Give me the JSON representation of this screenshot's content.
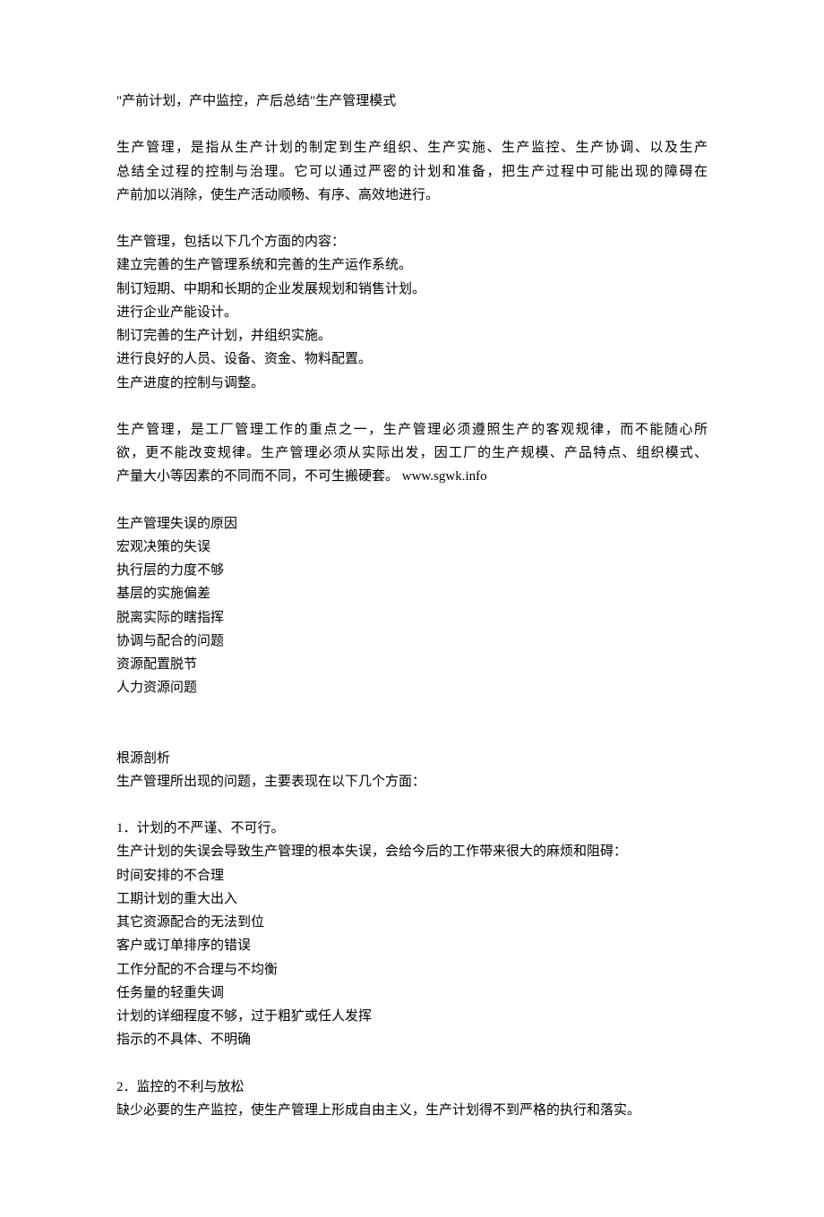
{
  "title": "\"产前计划，产中监控，产后总结\"生产管理模式",
  "intro_p1_l1": "生产管理，是指从生产计划的制定到生产组织、生产实施、生产监控、生产协调、以及生产",
  "intro_p1_l2": "总结全过程的控制与治理。它可以通过严密的计划和准备，把生产过程中可能出现的障碍在",
  "intro_p1_l3": "产前加以消除，使生产活动顺畅、有序、高效地进行。",
  "section1_header": "生产管理，包括以下几个方面的内容：",
  "section1_items": [
    "建立完善的生产管理系统和完善的生产运作系统。",
    "制订短期、中期和长期的企业发展规划和销售计划。",
    "进行企业产能设计。",
    "制订完善的生产计划，并组织实施。",
    "进行良好的人员、设备、资金、物料配置。",
    "生产进度的控制与调整。"
  ],
  "para3_l1": "生产管理，是工厂管理工作的重点之一，生产管理必须遵照生产的客观规律，而不能随心所",
  "para3_l2": "欲，更不能改变规律。生产管理必须从实际出发，因工厂的生产规模、产品特点、组织模式、",
  "para3_l3": "产量大小等因素的不同而不同，不可生搬硬套。 www.sgwk.info",
  "section2_header": "生产管理失误的原因",
  "section2_items": [
    "宏观决策的失误",
    "执行层的力度不够",
    "基层的实施偏差",
    "脱离实际的瞎指挥",
    "协调与配合的问题",
    "资源配置脱节",
    "人力资源问题"
  ],
  "section3_header": "根源剖析",
  "section3_sub": "生产管理所出现的问题，主要表现在以下几个方面：",
  "point1_title": "1．计划的不严谨、不可行。",
  "point1_desc": "生产计划的失误会导致生产管理的根本失误，会给今后的工作带来很大的麻烦和阻碍：",
  "point1_items": [
    "时间安排的不合理",
    "工期计划的重大出入",
    "其它资源配合的无法到位",
    "客户或订单排序的错误",
    "工作分配的不合理与不均衡",
    "任务量的轻重失调",
    "计划的详细程度不够，过于粗犷或任人发挥",
    "指示的不具体、不明确"
  ],
  "point2_title": "2．监控的不利与放松",
  "point2_desc": "缺少必要的生产监控，使生产管理上形成自由主义，生产计划得不到严格的执行和落实。"
}
